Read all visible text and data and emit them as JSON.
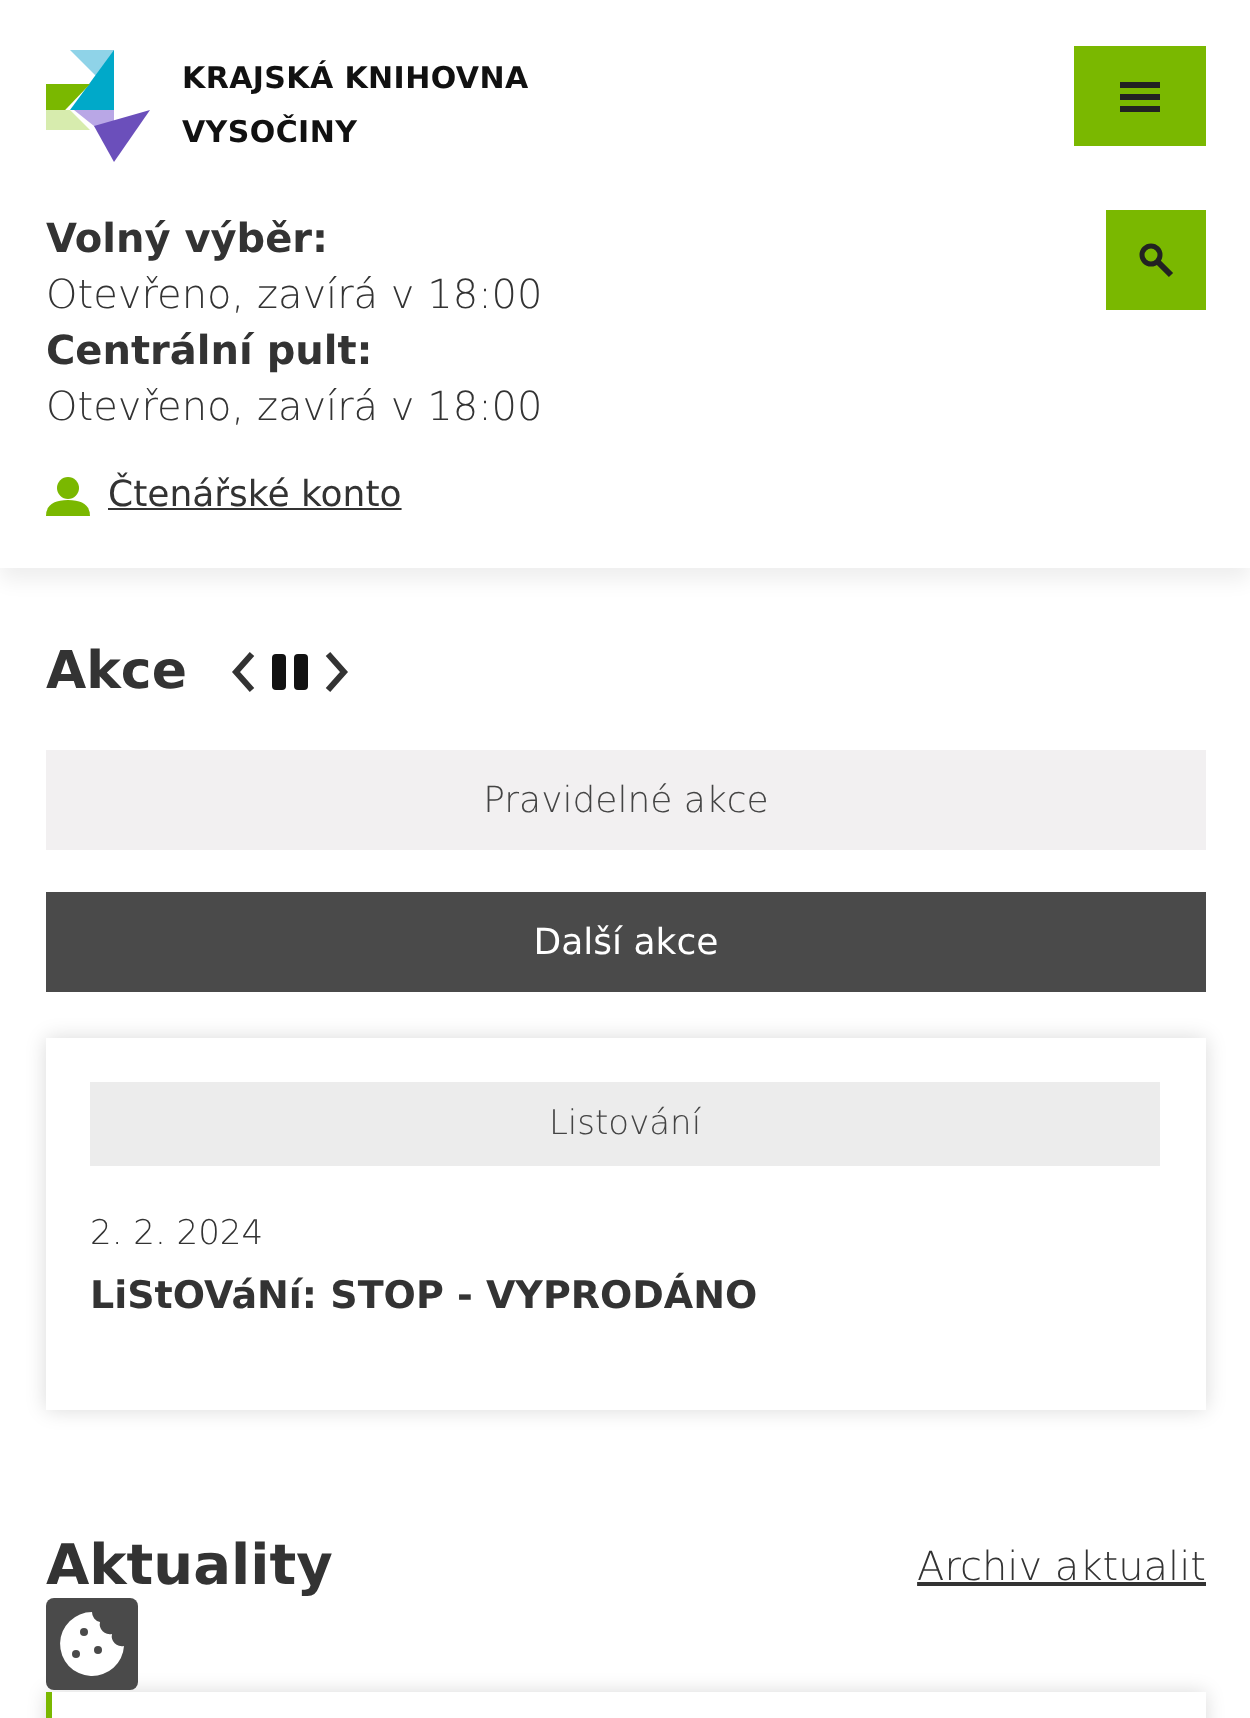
{
  "header": {
    "logo_text": [
      "KRAJSKÁ KNIHOVNA",
      "VYSOČINY"
    ],
    "hours": [
      {
        "label": "Volný výběr:",
        "status": "Otevřeno, zavírá v 18:00"
      },
      {
        "label": "Centrální pult:",
        "status": "Otevřeno, zavírá v 18:00"
      }
    ],
    "account_link": "Čtenářské konto"
  },
  "events": {
    "title": "Akce",
    "tabs": [
      {
        "label": "Pravidelné akce",
        "selected": false
      },
      {
        "label": "Další akce",
        "selected": true
      }
    ],
    "cards": [
      {
        "category": "Listování",
        "date": "2. 2. 2024",
        "title": "LiStOVáNí: STOP - VYPRODÁNO"
      }
    ]
  },
  "news": {
    "title": "Aktuality",
    "archive_link": "Archiv aktualit"
  }
}
